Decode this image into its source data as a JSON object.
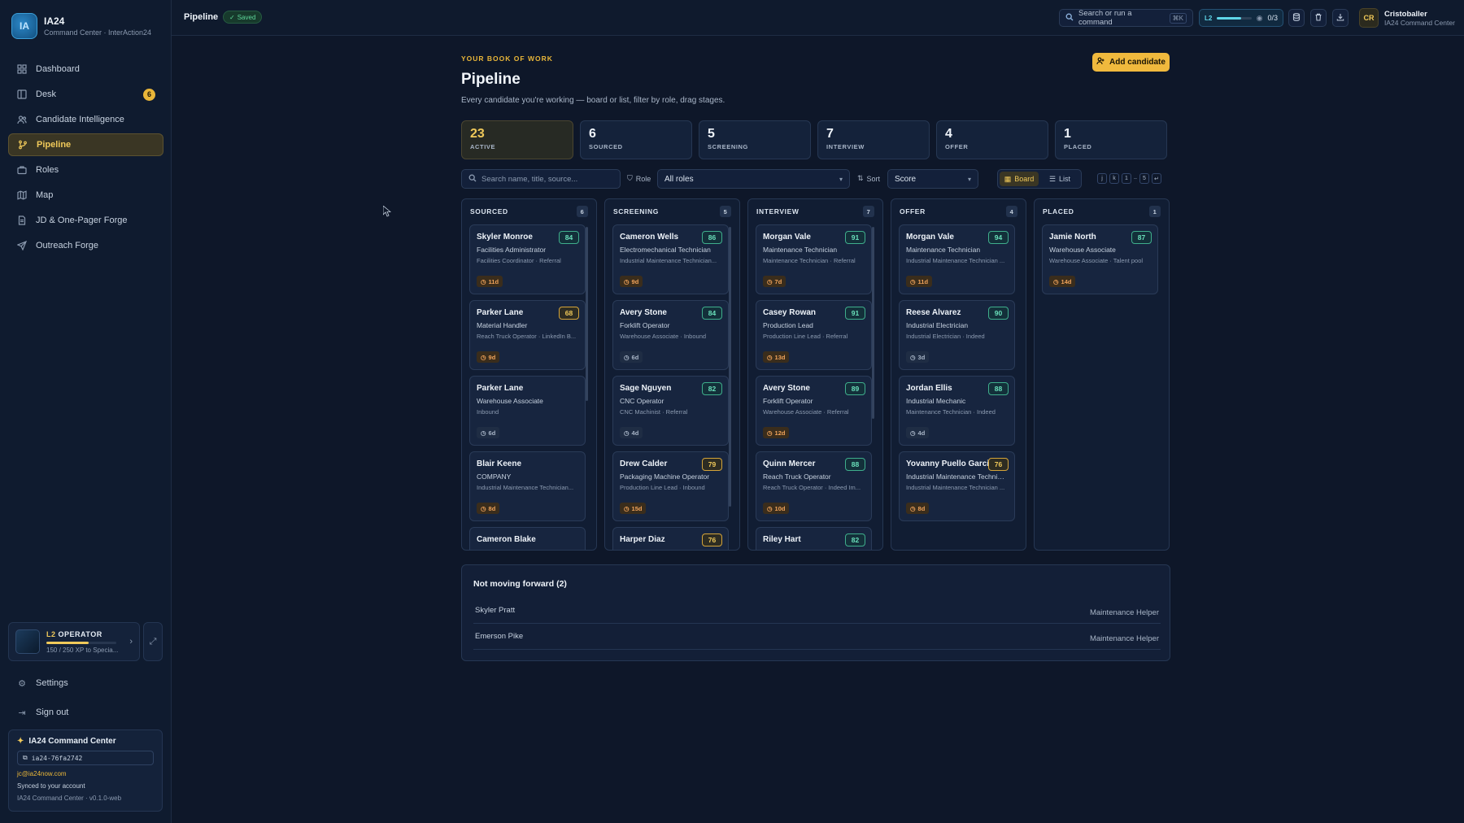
{
  "app": {
    "name": "IA24",
    "subtitle": "Command Center · InterAction24",
    "logo_text": "IA"
  },
  "sidebar": {
    "items": [
      {
        "label": "Dashboard",
        "icon": "grid-icon"
      },
      {
        "label": "Desk",
        "icon": "columns-icon",
        "badge": "6"
      },
      {
        "label": "Candidate Intelligence",
        "icon": "users-icon"
      },
      {
        "label": "Pipeline",
        "icon": "git-branch-icon",
        "active": true
      },
      {
        "label": "Roles",
        "icon": "briefcase-icon"
      },
      {
        "label": "Map",
        "icon": "map-icon"
      },
      {
        "label": "JD & One-Pager Forge",
        "icon": "file-text-icon"
      },
      {
        "label": "Outreach Forge",
        "icon": "send-icon"
      }
    ],
    "operator": {
      "level": "L2",
      "role": "OPERATOR",
      "xp_text": "150 / 250 XP to Specia...",
      "xp_progress": 0.6
    },
    "settings_label": "Settings",
    "signout_label": "Sign out",
    "command_center": {
      "title": "IA24 Command Center",
      "id": "ia24-76fa2742",
      "email": "jc@ia24now.com",
      "sync": "Synced to your account",
      "version": "IA24 Command Center · v0.1.0-web"
    }
  },
  "topbar": {
    "title": "Pipeline",
    "saved_label": "Saved",
    "search_placeholder": "Search or run a command",
    "search_shortcut": "⌘K",
    "level": "L2",
    "level_progress": "0/3",
    "user_initials": "CR",
    "user_name": "Cristoballer",
    "user_sub": "IA24 Command Center"
  },
  "page": {
    "eyebrow": "YOUR BOOK OF WORK",
    "title": "Pipeline",
    "subtitle": "Every candidate you're working — board or list, filter by role, drag stages.",
    "add_button": "Add candidate"
  },
  "stats": [
    {
      "value": "23",
      "label": "ACTIVE"
    },
    {
      "value": "6",
      "label": "SOURCED"
    },
    {
      "value": "5",
      "label": "SCREENING"
    },
    {
      "value": "7",
      "label": "INTERVIEW"
    },
    {
      "value": "4",
      "label": "OFFER"
    },
    {
      "value": "1",
      "label": "PLACED"
    }
  ],
  "filters": {
    "search_placeholder": "Search name, title, source...",
    "role_label": "Role",
    "role_value": "All roles",
    "sort_label": "Sort",
    "sort_value": "Score",
    "board_label": "Board",
    "list_label": "List",
    "keys": [
      "j",
      "k",
      "1",
      "5",
      "↵"
    ]
  },
  "columns": [
    {
      "name": "SOURCED",
      "count": "6",
      "cards": [
        {
          "name": "Skyler Monroe",
          "score": "84",
          "title": "Facilities Administrator",
          "meta": "Facilities Coordinator · Referral",
          "days": "11d",
          "level": "hi",
          "aging": "warn"
        },
        {
          "name": "Parker Lane",
          "score": "68",
          "title": "Material Handler",
          "meta": "Reach Truck Operator · LinkedIn B...",
          "days": "9d",
          "level": "mid",
          "aging": "warn"
        },
        {
          "name": "Parker Lane",
          "score": "",
          "title": "Warehouse Associate",
          "meta": "Inbound",
          "days": "6d",
          "level": "",
          "aging": "ok"
        },
        {
          "name": "Blair Keene",
          "score": "",
          "title": "COMPANY",
          "meta": "Industrial Maintenance Technician...",
          "days": "8d",
          "level": "",
          "aging": "warn"
        },
        {
          "name": "Cameron Blake",
          "score": "",
          "title": "",
          "meta": "",
          "days": "",
          "level": "",
          "aging": ""
        }
      ]
    },
    {
      "name": "SCREENING",
      "count": "5",
      "cards": [
        {
          "name": "Cameron Wells",
          "score": "86",
          "title": "Electromechanical Technician",
          "meta": "Industrial Maintenance Technician...",
          "days": "9d",
          "level": "hi",
          "aging": "warn"
        },
        {
          "name": "Avery Stone",
          "score": "84",
          "title": "Forklift Operator",
          "meta": "Warehouse Associate · Inbound",
          "days": "6d",
          "level": "hi",
          "aging": "ok"
        },
        {
          "name": "Sage Nguyen",
          "score": "82",
          "title": "CNC Operator",
          "meta": "CNC Machinist · Referral",
          "days": "4d",
          "level": "hi",
          "aging": "ok"
        },
        {
          "name": "Drew Calder",
          "score": "79",
          "title": "Packaging Machine Operator",
          "meta": "Production Line Lead · Inbound",
          "days": "15d",
          "level": "mid",
          "aging": "warn"
        },
        {
          "name": "Harper Diaz",
          "score": "76",
          "title": "",
          "meta": "",
          "days": "",
          "level": "mid",
          "aging": ""
        }
      ]
    },
    {
      "name": "INTERVIEW",
      "count": "7",
      "cards": [
        {
          "name": "Morgan Vale",
          "score": "91",
          "title": "Maintenance Technician",
          "meta": "Maintenance Technician · Referral",
          "days": "7d",
          "level": "hi",
          "aging": "warn"
        },
        {
          "name": "Casey Rowan",
          "score": "91",
          "title": "Production Lead",
          "meta": "Production Line Lead · Referral",
          "days": "13d",
          "level": "hi",
          "aging": "warn"
        },
        {
          "name": "Avery Stone",
          "score": "89",
          "title": "Forklift Operator",
          "meta": "Warehouse Associate · Referral",
          "days": "12d",
          "level": "hi",
          "aging": "warn"
        },
        {
          "name": "Quinn Mercer",
          "score": "88",
          "title": "Reach Truck Operator",
          "meta": "Reach Truck Operator · Indeed Im...",
          "days": "10d",
          "level": "hi",
          "aging": "warn"
        },
        {
          "name": "Riley Hart",
          "score": "82",
          "title": "",
          "meta": "",
          "days": "",
          "level": "hi",
          "aging": ""
        }
      ]
    },
    {
      "name": "OFFER",
      "count": "4",
      "cards": [
        {
          "name": "Morgan Vale",
          "score": "94",
          "title": "Maintenance Technician",
          "meta": "Industrial Maintenance Technician ...",
          "days": "11d",
          "level": "hi",
          "aging": "warn"
        },
        {
          "name": "Reese Alvarez",
          "score": "90",
          "title": "Industrial Electrician",
          "meta": "Industrial Electrician · Indeed",
          "days": "3d",
          "level": "hi",
          "aging": "ok"
        },
        {
          "name": "Jordan Ellis",
          "score": "88",
          "title": "Industrial Mechanic",
          "meta": "Maintenance Technician · Indeed",
          "days": "4d",
          "level": "hi",
          "aging": "ok"
        },
        {
          "name": "Yovanny Puello Garcia",
          "score": "76",
          "title": "Industrial Maintenance Technician",
          "meta": "Industrial Maintenance Technician ...",
          "days": "8d",
          "level": "mid",
          "aging": "warn"
        }
      ]
    },
    {
      "name": "PLACED",
      "count": "1",
      "cards": [
        {
          "name": "Jamie North",
          "score": "87",
          "title": "Warehouse Associate",
          "meta": "Warehouse Associate · Talent pool",
          "days": "14d",
          "level": "hi",
          "aging": "warn"
        }
      ]
    }
  ],
  "not_moving": {
    "title": "Not moving forward (2)",
    "rows": [
      {
        "name": "Skyler Pratt",
        "role": "Maintenance Helper"
      },
      {
        "name": "Emerson Pike",
        "role": "Maintenance Helper"
      }
    ]
  }
}
